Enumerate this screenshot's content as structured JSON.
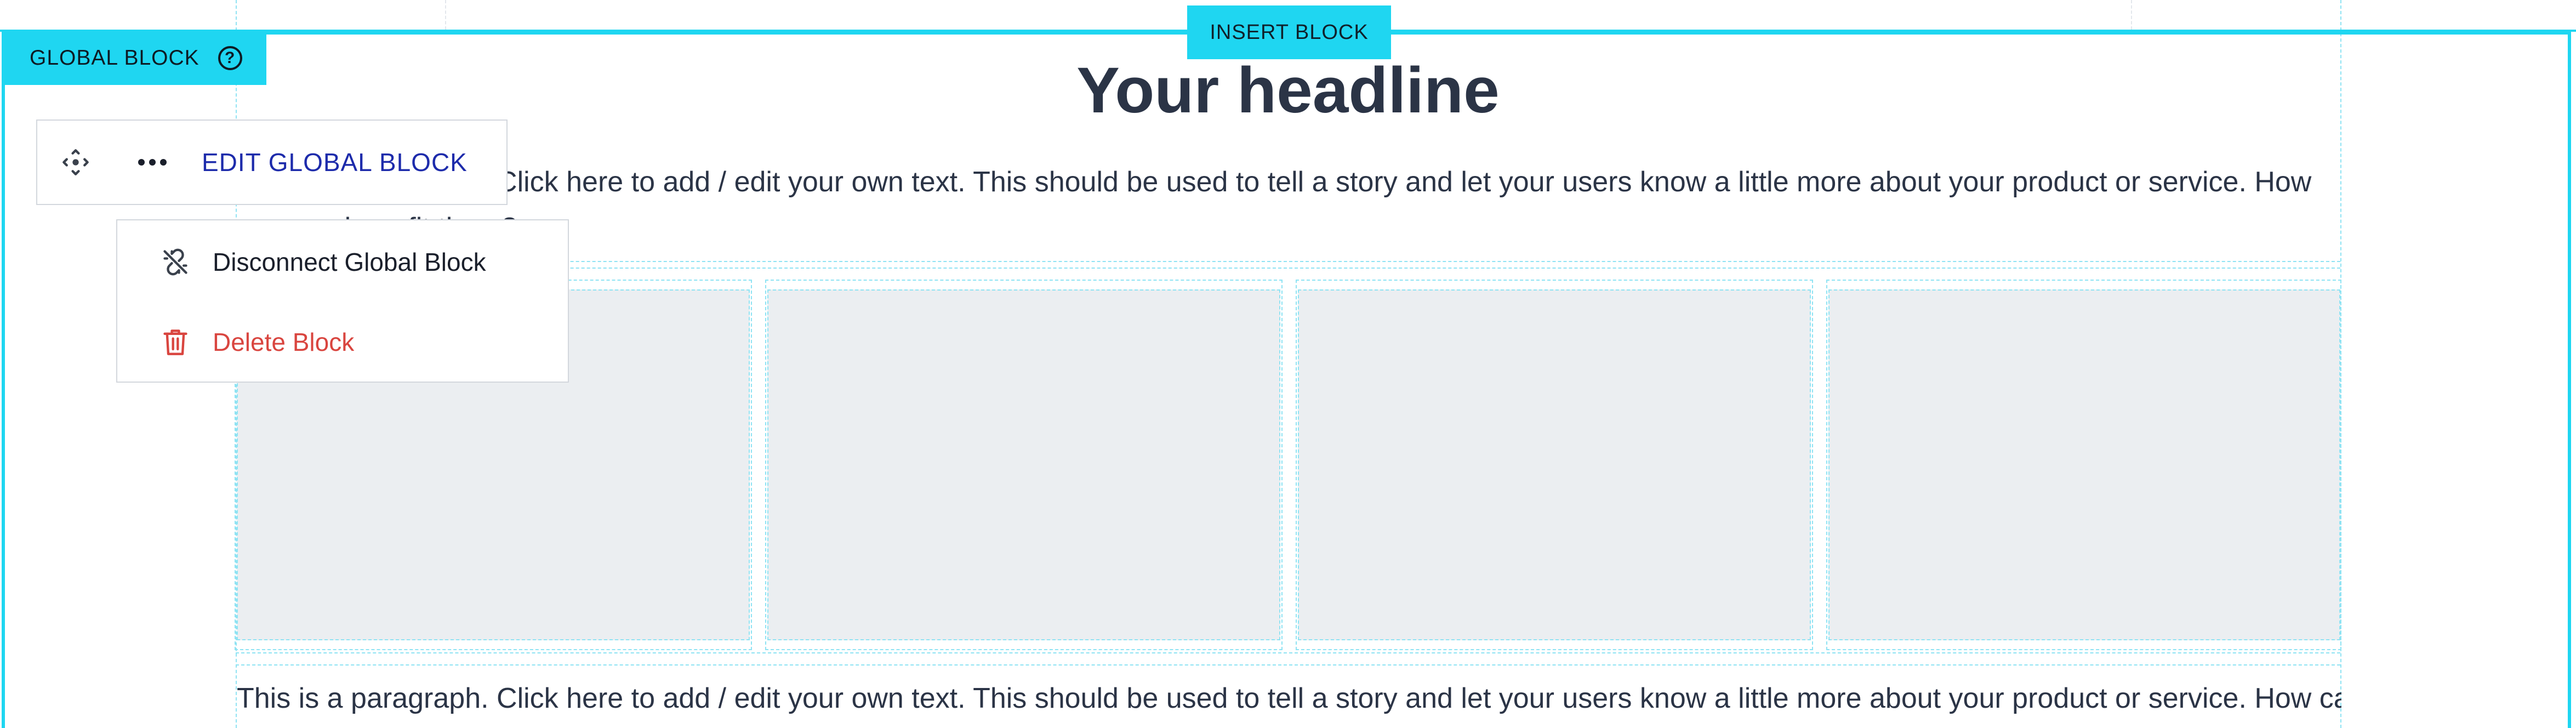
{
  "editor": {
    "insert_block_label": "INSERT BLOCK",
    "global_block_tag_label": "GLOBAL BLOCK",
    "help_symbol": "?",
    "accent_color": "#1fd6f1"
  },
  "toolbar": {
    "move_icon": "move-arrows-icon",
    "more_icon": "ellipsis-icon",
    "edit_label": "EDIT GLOBAL BLOCK"
  },
  "menu": {
    "items": [
      {
        "label": "Disconnect Global Block",
        "icon": "unlink-icon",
        "color": "#1a1f2b"
      },
      {
        "label": "Delete Block",
        "icon": "trash-icon",
        "color": "#d9453f"
      }
    ]
  },
  "content": {
    "headline": "Your headline",
    "paragraph_1": "This is a paragraph. Click here to add / edit your own text. This should be used to tell a story and let your users know a little more about your product or service. How can you benefit them?",
    "paragraph_2": "This is a paragraph. Click here to add / edit your own text. This should be used to tell a story and let your users know a little more about your product or service. How can",
    "image_placeholders": [
      "image-1",
      "image-2",
      "image-3",
      "image-4"
    ]
  }
}
